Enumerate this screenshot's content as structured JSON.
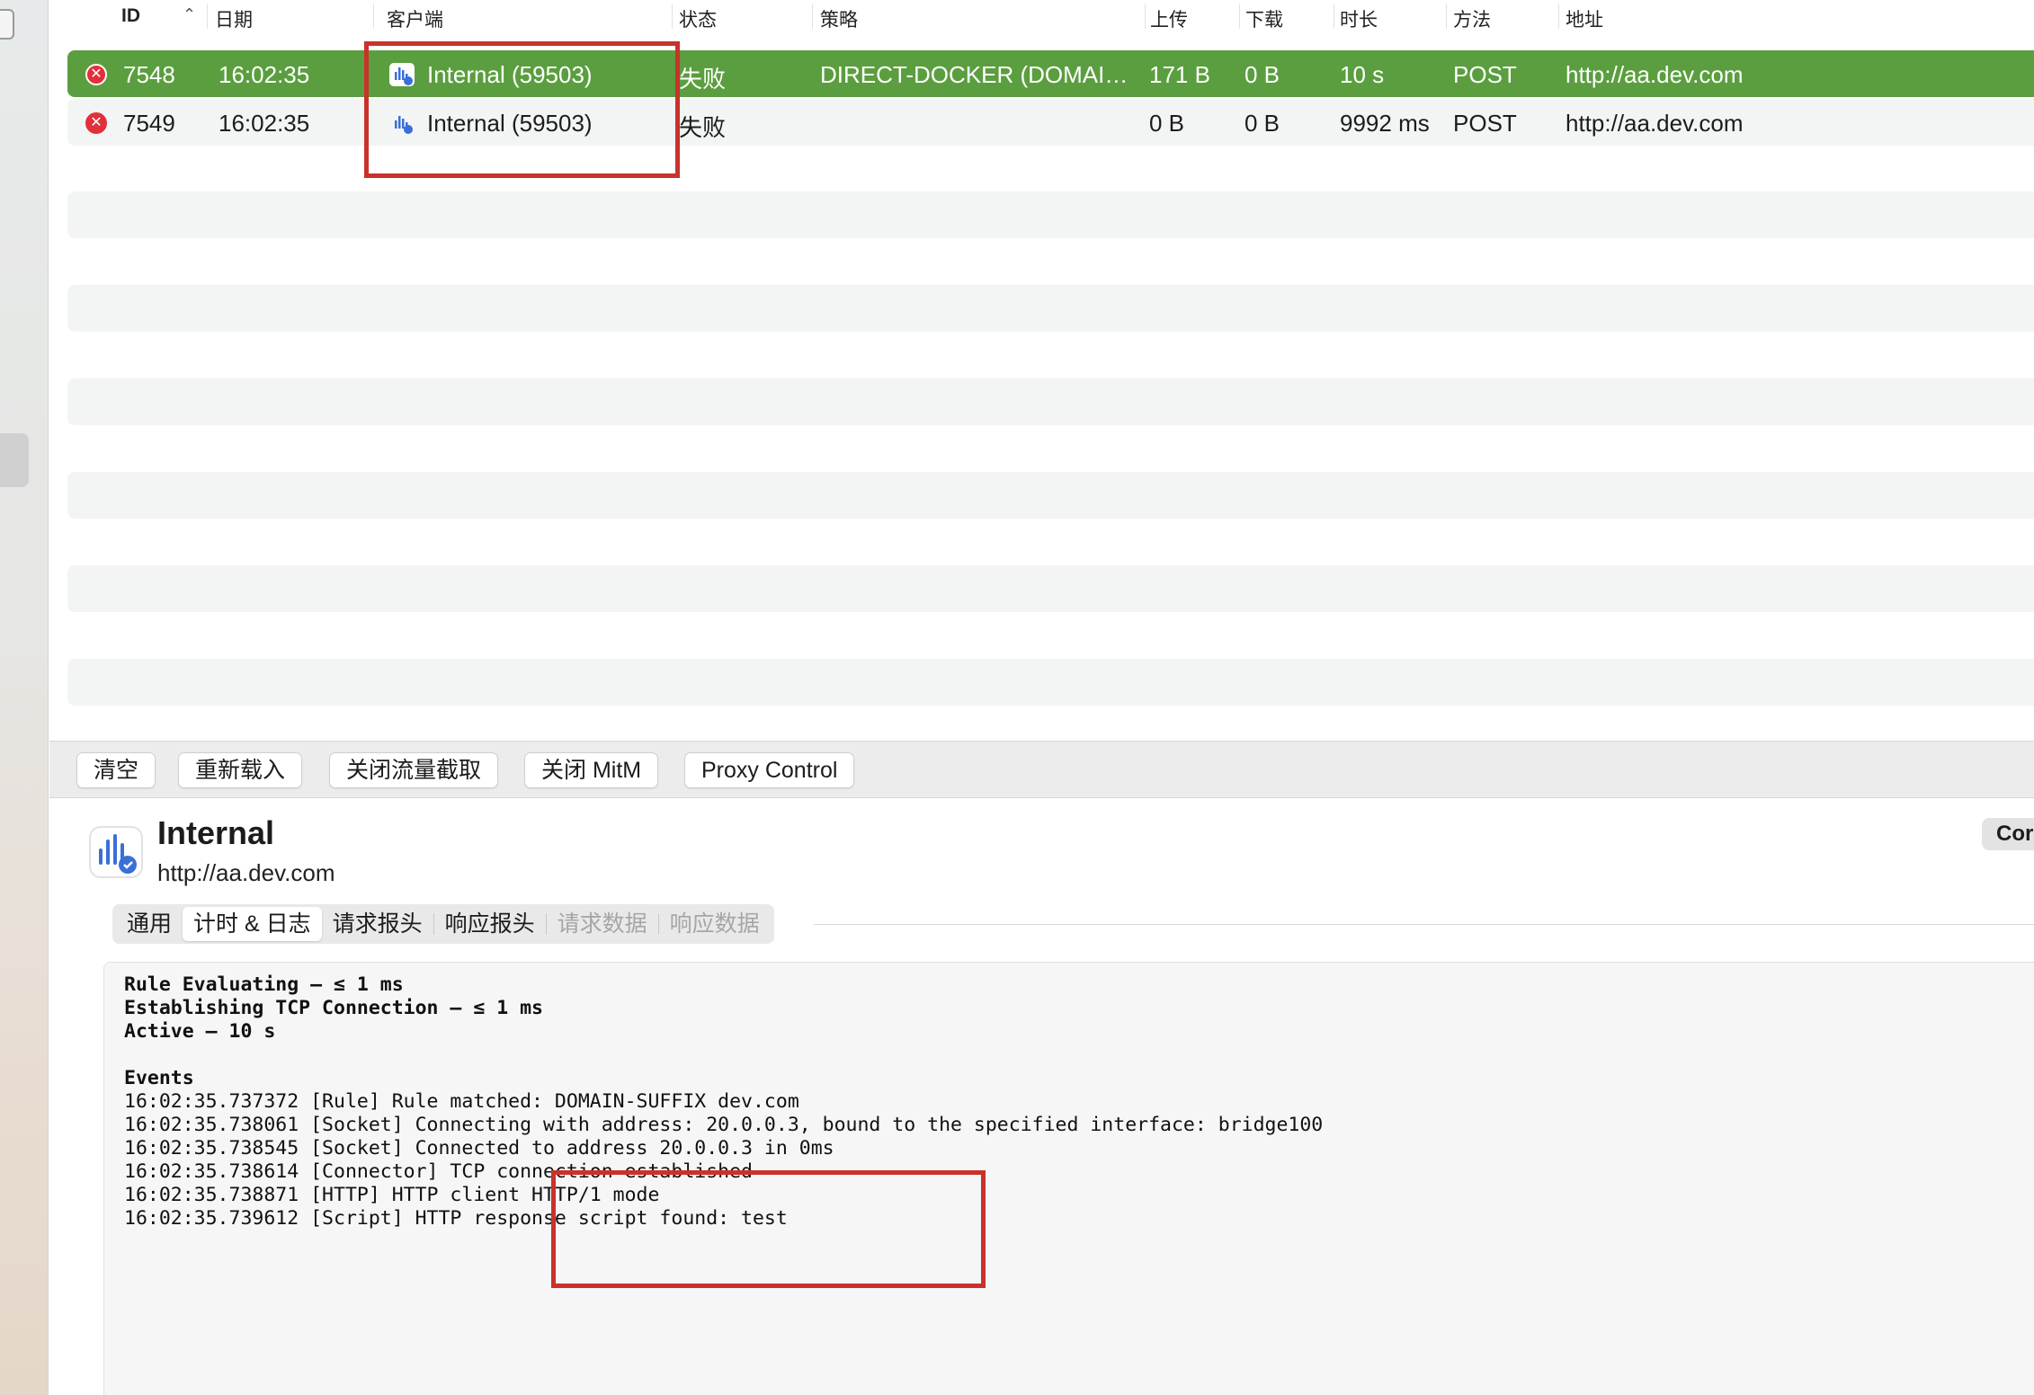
{
  "columns": {
    "id": "ID",
    "date": "日期",
    "client": "客户端",
    "status": "状态",
    "policy": "策略",
    "upload": "上传",
    "download": "下载",
    "duration": "时长",
    "method": "方法",
    "address": "地址"
  },
  "rows": [
    {
      "id": "7548",
      "time": "16:02:35",
      "client": "Internal (59503)",
      "status": "失败",
      "policy": "DIRECT-DOCKER (DOMAI…",
      "upload": "171 B",
      "download": "0 B",
      "duration": "10 s",
      "method": "POST",
      "address": "http://aa.dev.com"
    },
    {
      "id": "7549",
      "time": "16:02:35",
      "client": "Internal (59503)",
      "status": "失败",
      "policy": "",
      "upload": "0 B",
      "download": "0 B",
      "duration": "9992 ms",
      "method": "POST",
      "address": "http://aa.dev.com"
    }
  ],
  "toolbar": {
    "clear": "清空",
    "reload": "重新载入",
    "close_capture": "关闭流量截取",
    "close_mitm": "关闭 MitM",
    "proxy_control": "Proxy Control"
  },
  "detail": {
    "title": "Internal",
    "url": "http://aa.dev.com",
    "pill": "Cor"
  },
  "tabs": [
    {
      "label": "通用",
      "state": "normal"
    },
    {
      "label": "计时 & 日志",
      "state": "active"
    },
    {
      "label": "请求报头",
      "state": "normal"
    },
    {
      "label": "响应报头",
      "state": "normal"
    },
    {
      "label": "请求数据",
      "state": "disabled"
    },
    {
      "label": "响应数据",
      "state": "disabled"
    }
  ],
  "log": {
    "timing": [
      "Rule Evaluating – ≤ 1 ms",
      "Establishing TCP Connection – ≤ 1 ms",
      "Active – 10 s"
    ],
    "events_heading": "Events",
    "events": [
      "16:02:35.737372 [Rule] Rule matched: DOMAIN-SUFFIX dev.com",
      "16:02:35.738061 [Socket] Connecting with address: 20.0.0.3, bound to the specified interface: bridge100",
      "16:02:35.738545 [Socket] Connected to address 20.0.0.3 in 0ms",
      "16:02:35.738614 [Connector] TCP connection established",
      "16:02:35.738871 [HTTP] HTTP client HTTP/1 mode",
      "16:02:35.739612 [Script] HTTP response script found: test"
    ]
  },
  "colors": {
    "selected_row": "#5b9e3f",
    "error_icon": "#e0313a",
    "highlight_box": "#c9322b",
    "app_icon_blue": "#3a6fd8"
  },
  "icons": {
    "row_status": "error-x-icon",
    "client": "network-activity-app-icon",
    "sort": "chevron-up-icon"
  }
}
